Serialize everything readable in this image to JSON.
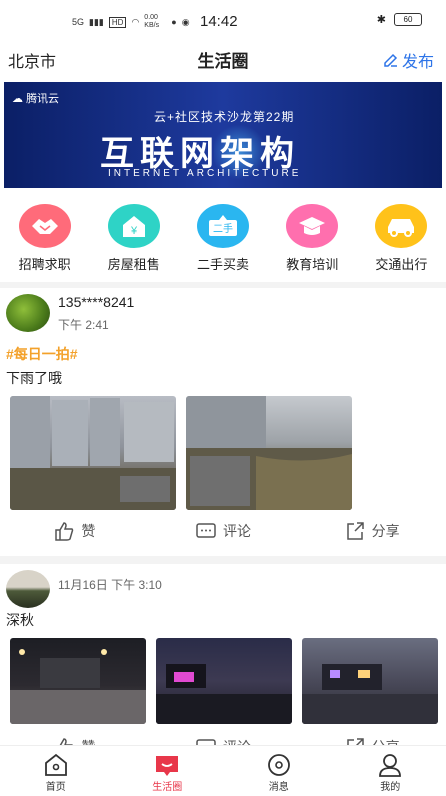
{
  "status": {
    "network": "5G",
    "hd": "HD",
    "speed": "0.00 KB/s",
    "time": "14:42",
    "battery": "60"
  },
  "header": {
    "city": "北京市",
    "title": "生活圈",
    "publish": "发布"
  },
  "banner": {
    "brand": "腾讯云",
    "subtitle": "云+社区技术沙龙第22期",
    "title": "互联网架构",
    "title_en": "INTERNET ARCHITECTURE"
  },
  "categories": [
    {
      "label": "招聘求职",
      "color": "#ff6b7a",
      "icon": "handshake-icon"
    },
    {
      "label": "房屋租售",
      "color": "#2ed3c6",
      "icon": "house-icon"
    },
    {
      "label": "二手买卖",
      "color": "#2ab6f0",
      "icon": "secondhand-icon"
    },
    {
      "label": "教育培训",
      "color": "#ff6fae",
      "icon": "graduation-cap-icon"
    },
    {
      "label": "交通出行",
      "color": "#ffc21a",
      "icon": "car-icon"
    }
  ],
  "posts": [
    {
      "user": "135****8241",
      "time": "下午 2:41",
      "tag": "#每日一拍#",
      "text": "下雨了哦"
    },
    {
      "user": "",
      "time": "11月16日 下午 3:10",
      "tag": "",
      "text": "深秋"
    }
  ],
  "actions": {
    "like": "赞",
    "comment": "评论",
    "share": "分享"
  },
  "tabs": [
    {
      "label": "首页",
      "icon": "home-icon"
    },
    {
      "label": "生活圈",
      "icon": "life-circle-icon"
    },
    {
      "label": "消息",
      "icon": "message-icon"
    },
    {
      "label": "我的",
      "icon": "profile-icon"
    }
  ],
  "colors": {
    "accent": "#2d74e8",
    "active_tab": "#e8374a",
    "tag": "#f3a12a"
  }
}
